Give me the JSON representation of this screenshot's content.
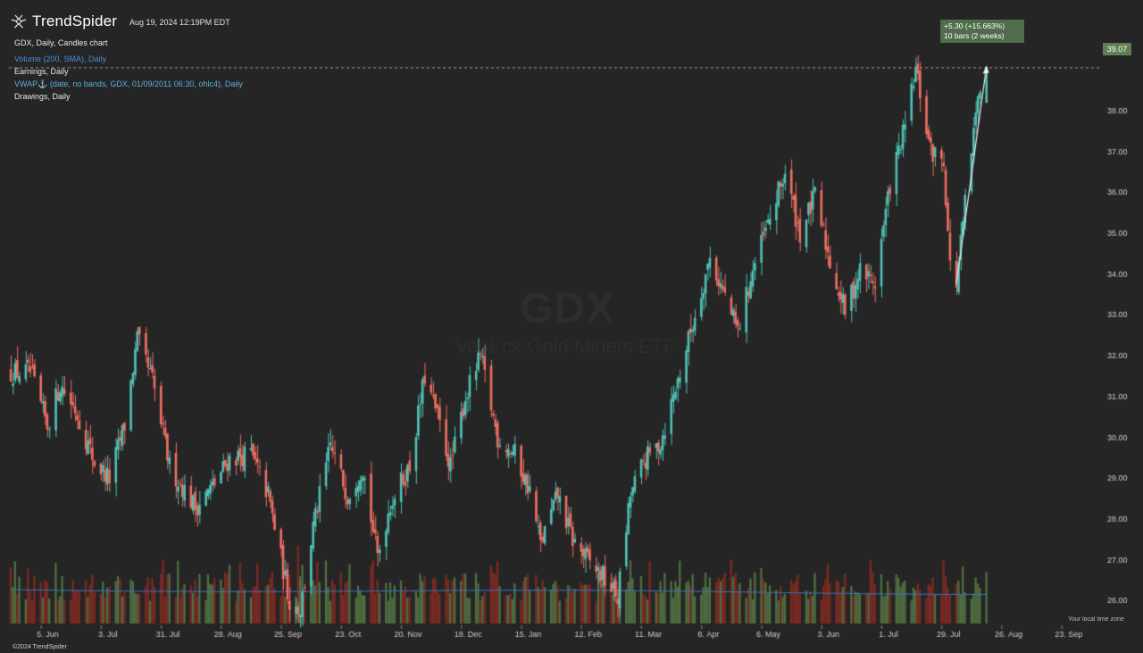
{
  "header": {
    "brand": "TrendSpider",
    "timestamp": "Aug 19, 2024 12:19PM EDT",
    "indicators": [
      {
        "label": "GDX, Daily, Candles chart",
        "color": "#ffffff"
      },
      {
        "label": "Volume (200, SMA), Daily",
        "color": "#4a8fd6"
      },
      {
        "label": "Earnings, Daily",
        "color": "#ffffff"
      },
      {
        "label": "VWAP⚓ (date, no bands, GDX, 01/09/2011 06:30, ohlc4), Daily",
        "color": "#5ab0e0"
      },
      {
        "label": "Drawings, Daily",
        "color": "#ffffff"
      }
    ]
  },
  "watermark": {
    "symbol": "GDX",
    "name": "VanEck Gold Miners ETF"
  },
  "footer": {
    "copyright": "©2024 TrendSpider",
    "timezone": "Your local time zone"
  },
  "last_price": "39.07",
  "measure": {
    "line1": "+5.30 (+15.663%)",
    "line2": "10 bars (2 weeks)",
    "from": 33.77,
    "to": 39.07
  },
  "colors": {
    "background": "#252525",
    "up": "#4fc1b5",
    "down": "#ef6e62",
    "vol_up": "#4f6d40",
    "vol_down": "#7a2a22",
    "vol_sma": "#3a78c8",
    "axis_text": "#cccccc"
  },
  "chart_data": {
    "type": "candlestick",
    "symbol": "GDX",
    "interval": "Daily",
    "ylim": [
      25.3,
      39.8
    ],
    "y_ticks": [
      "26.00",
      "27.00",
      "28.00",
      "29.00",
      "30.00",
      "31.00",
      "32.00",
      "33.00",
      "34.00",
      "35.00",
      "36.00",
      "37.00",
      "38.00"
    ],
    "x_ticks": [
      "5. Jun",
      "3. Jul",
      "31. Jul",
      "28. Aug",
      "25. Sep",
      "23. Oct",
      "20. Nov",
      "18. Dec",
      "15. Jan",
      "12. Feb",
      "11. Mar",
      "8. Apr",
      "6. May",
      "3. Jun",
      "1. Jul",
      "29. Jul",
      "26. Aug",
      "23. Sep"
    ],
    "close_path": [
      {
        "date": "2023-05-31",
        "close": 31.6
      },
      {
        "date": "2023-06-08",
        "close": 30.3
      },
      {
        "date": "2023-06-14",
        "close": 31.3
      },
      {
        "date": "2023-06-21",
        "close": 30.7
      },
      {
        "date": "2023-06-30",
        "close": 29.4
      },
      {
        "date": "2023-07-07",
        "close": 29.0
      },
      {
        "date": "2023-07-14",
        "close": 30.3
      },
      {
        "date": "2023-07-20",
        "close": 32.4
      },
      {
        "date": "2023-07-27",
        "close": 31.4
      },
      {
        "date": "2023-08-04",
        "close": 29.3
      },
      {
        "date": "2023-08-16",
        "close": 28.3
      },
      {
        "date": "2023-08-24",
        "close": 28.8
      },
      {
        "date": "2023-09-01",
        "close": 29.5
      },
      {
        "date": "2023-09-11",
        "close": 29.6
      },
      {
        "date": "2023-09-19",
        "close": 28.6
      },
      {
        "date": "2023-09-29",
        "close": 26.0
      },
      {
        "date": "2023-10-04",
        "close": 25.8
      },
      {
        "date": "2023-10-10",
        "close": 27.8
      },
      {
        "date": "2023-10-18",
        "close": 29.8
      },
      {
        "date": "2023-10-26",
        "close": 28.6
      },
      {
        "date": "2023-11-02",
        "close": 29.3
      },
      {
        "date": "2023-11-09",
        "close": 27.1
      },
      {
        "date": "2023-11-15",
        "close": 28.4
      },
      {
        "date": "2023-11-24",
        "close": 29.3
      },
      {
        "date": "2023-12-01",
        "close": 31.5
      },
      {
        "date": "2023-12-07",
        "close": 30.5
      },
      {
        "date": "2023-12-13",
        "close": 29.3
      },
      {
        "date": "2023-12-20",
        "close": 31.0
      },
      {
        "date": "2023-12-27",
        "close": 32.0
      },
      {
        "date": "2024-01-04",
        "close": 30.0
      },
      {
        "date": "2024-01-12",
        "close": 29.6
      },
      {
        "date": "2024-01-19",
        "close": 28.7
      },
      {
        "date": "2024-01-24",
        "close": 27.4
      },
      {
        "date": "2024-02-01",
        "close": 28.6
      },
      {
        "date": "2024-02-08",
        "close": 27.5
      },
      {
        "date": "2024-02-15",
        "close": 27.0
      },
      {
        "date": "2024-02-22",
        "close": 26.6
      },
      {
        "date": "2024-02-29",
        "close": 26.1
      },
      {
        "date": "2024-03-06",
        "close": 28.6
      },
      {
        "date": "2024-03-12",
        "close": 29.4
      },
      {
        "date": "2024-03-20",
        "close": 29.9
      },
      {
        "date": "2024-03-28",
        "close": 31.4
      },
      {
        "date": "2024-04-05",
        "close": 33.0
      },
      {
        "date": "2024-04-12",
        "close": 34.4
      },
      {
        "date": "2024-04-18",
        "close": 33.6
      },
      {
        "date": "2024-04-25",
        "close": 32.6
      },
      {
        "date": "2024-05-02",
        "close": 34.1
      },
      {
        "date": "2024-05-09",
        "close": 35.2
      },
      {
        "date": "2024-05-17",
        "close": 36.5
      },
      {
        "date": "2024-05-24",
        "close": 35.0
      },
      {
        "date": "2024-05-31",
        "close": 35.9
      },
      {
        "date": "2024-06-07",
        "close": 34.3
      },
      {
        "date": "2024-06-14",
        "close": 33.1
      },
      {
        "date": "2024-06-21",
        "close": 34.1
      },
      {
        "date": "2024-06-28",
        "close": 33.8
      },
      {
        "date": "2024-07-05",
        "close": 36.2
      },
      {
        "date": "2024-07-12",
        "close": 37.6
      },
      {
        "date": "2024-07-17",
        "close": 39.0
      },
      {
        "date": "2024-07-24",
        "close": 37.0
      },
      {
        "date": "2024-07-30",
        "close": 36.8
      },
      {
        "date": "2024-08-02",
        "close": 34.2
      },
      {
        "date": "2024-08-05",
        "close": 33.8
      },
      {
        "date": "2024-08-09",
        "close": 35.7
      },
      {
        "date": "2024-08-16",
        "close": 38.7
      },
      {
        "date": "2024-08-19",
        "close": 39.07
      }
    ]
  }
}
